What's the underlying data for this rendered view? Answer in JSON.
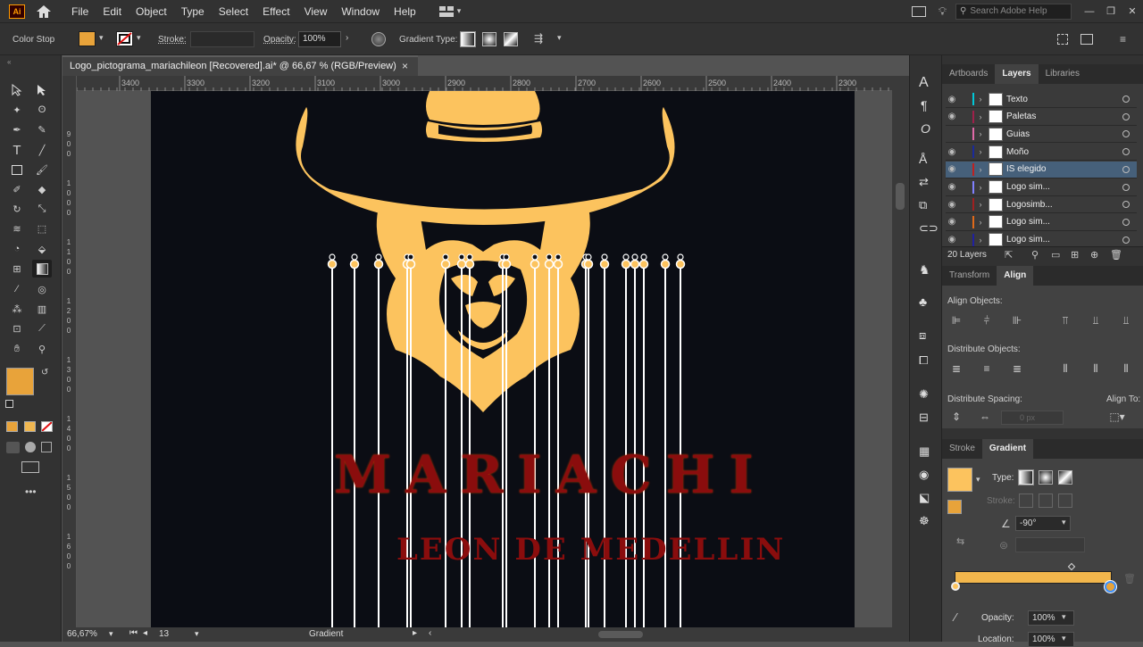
{
  "menu": {
    "logo": "Ai",
    "items": [
      "File",
      "Edit",
      "Object",
      "Type",
      "Select",
      "Effect",
      "View",
      "Window",
      "Help"
    ],
    "search_placeholder": "Search Adobe Help"
  },
  "control_bar": {
    "context_label": "Color Stop",
    "stroke_label": "Stroke:",
    "opacity_label": "Opacity:",
    "opacity_value": "100%",
    "gradient_type_label": "Gradient Type:",
    "fill_color": "#e8a33a"
  },
  "document": {
    "tab_title": "Logo_pictograma_mariachileon [Recovered].ai* @ 66,67 % (RGB/Preview)",
    "close": "×"
  },
  "ruler": {
    "h_ticks": [
      "3400",
      "3300",
      "3200",
      "3100",
      "3000",
      "2900",
      "2800",
      "2700",
      "2600",
      "2500",
      "2400",
      "2300"
    ]
  },
  "artwork": {
    "title_text": "MARIACHI",
    "subtitle_text": "LEON DE MEDELLIN",
    "hat_color": "#fcc35e",
    "text_color": "#8a0d0d",
    "background": "#0b0d14"
  },
  "status_bar": {
    "zoom": "66,67%",
    "artboard": "13",
    "tool": "Gradient"
  },
  "layers_panel": {
    "tabs": [
      "Artboards",
      "Layers",
      "Libraries"
    ],
    "active_tab": "Layers",
    "layers": [
      {
        "name": "Texto",
        "color": "#00c8d8",
        "visible": true
      },
      {
        "name": "Paletas",
        "color": "#a0204a",
        "visible": true
      },
      {
        "name": "Guias",
        "color": "#e06aa8",
        "visible": false
      },
      {
        "name": "Moño",
        "color": "#1a2a9a",
        "visible": true
      },
      {
        "name": "IS elegido",
        "color": "#c02020",
        "visible": true,
        "selected": true
      },
      {
        "name": "Logo sim...",
        "color": "#8080ff",
        "visible": true
      },
      {
        "name": "Logosimb...",
        "color": "#a02020",
        "visible": true
      },
      {
        "name": "Logo sim...",
        "color": "#e06a1a",
        "visible": true
      },
      {
        "name": "Logo sim...",
        "color": "#2020a0",
        "visible": true
      }
    ],
    "count": "20 Layers"
  },
  "align_panel": {
    "tabs": [
      "Transform",
      "Align"
    ],
    "active_tab": "Align",
    "align_objects": "Align Objects:",
    "distribute_objects": "Distribute Objects:",
    "distribute_spacing": "Distribute Spacing:",
    "align_to": "Align To:",
    "spacing_value": "0 px"
  },
  "gradient_panel": {
    "tabs": [
      "Stroke",
      "Gradient"
    ],
    "active_tab": "Gradient",
    "type_label": "Type:",
    "stroke_label": "Stroke:",
    "angle_value": "-90°",
    "opacity_label": "Opacity:",
    "opacity_value": "100%",
    "location_label": "Location:",
    "location_value": "100%",
    "gradient_color": "#f2b64c"
  }
}
